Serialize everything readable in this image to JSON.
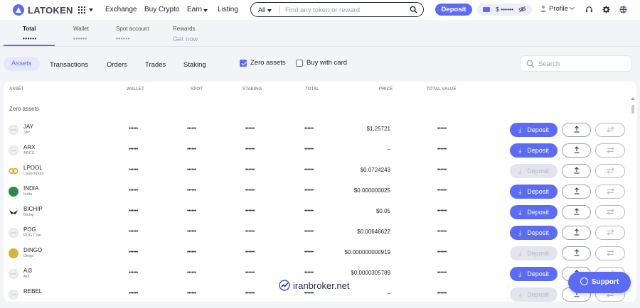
{
  "brand": {
    "name": "LATOKEN"
  },
  "nav": {
    "items": [
      "Exchange",
      "Buy Crypto",
      "Earn",
      "Listing"
    ]
  },
  "search": {
    "scope": "All",
    "placeholder": "Find any token or reward"
  },
  "header": {
    "deposit_label": "Deposit",
    "balance_masked": "$ ••••••",
    "profile_label": "Profile"
  },
  "summary_tabs": [
    {
      "label": "Total",
      "value": "••••••"
    },
    {
      "label": "Wallet",
      "value": "••••••"
    },
    {
      "label": "Spot account",
      "value": "••••••"
    },
    {
      "label": "Rewards",
      "value": "Get now"
    }
  ],
  "sub_tabs": [
    "Assets",
    "Transactions",
    "Orders",
    "Trades",
    "Staking"
  ],
  "filters": {
    "zero_assets": {
      "label": "Zero assets",
      "checked": true
    },
    "buy_with_card": {
      "label": "Buy with card",
      "checked": false
    }
  },
  "asset_search": {
    "placeholder": "Search"
  },
  "table": {
    "headers": [
      "ASSET",
      "WALLET",
      "SPOT",
      "STAKING",
      "TOTAL",
      "PRICE",
      "TOTAL VALUE"
    ],
    "section_caption": "Zero assets",
    "rows": [
      {
        "symbol": "JAY",
        "name": "JAY",
        "wallet": "••••••",
        "spot": "••••••",
        "staking": "••••••",
        "total": "••••••",
        "price": "$1.25721",
        "total_value": "••••••",
        "deposit_enabled": true
      },
      {
        "symbol": "ARX",
        "name": "ARCS",
        "wallet": "••••••",
        "spot": "••••••",
        "staking": "••••••",
        "total": "••••••",
        "price": "–",
        "total_value": "••••••",
        "deposit_enabled": true
      },
      {
        "symbol": "LPOOL",
        "name": "Launchpool",
        "wallet": "••••••",
        "spot": "••••••",
        "staking": "••••••",
        "total": "••••••",
        "price": "$0.0724243",
        "total_value": "••••••",
        "deposit_enabled": false
      },
      {
        "symbol": "INDIA",
        "name": "India",
        "wallet": "••••••",
        "spot": "••••••",
        "staking": "••••••",
        "total": "••••••",
        "price": "$0.000000025",
        "total_value": "••••••",
        "deposit_enabled": true
      },
      {
        "symbol": "BICHIP",
        "name": "Bichip",
        "wallet": "••••••",
        "spot": "••••••",
        "staking": "••••••",
        "total": "••••••",
        "price": "$0.05",
        "total_value": "••••••",
        "deposit_enabled": true
      },
      {
        "symbol": "POG",
        "name": "POG Coin",
        "wallet": "••••••",
        "spot": "••••••",
        "staking": "••••••",
        "total": "••••••",
        "price": "$0.00646622",
        "total_value": "••••••",
        "deposit_enabled": true
      },
      {
        "symbol": "DINGO",
        "name": "Dingo",
        "wallet": "••••••",
        "spot": "••••••",
        "staking": "••••••",
        "total": "••••••",
        "price": "$0.000000000919",
        "total_value": "••••••",
        "deposit_enabled": false
      },
      {
        "symbol": "AI3",
        "name": "AI3",
        "wallet": "••••••",
        "spot": "••••••",
        "staking": "••••••",
        "total": "••••••",
        "price": "$0.0000305789",
        "total_value": "••••••",
        "deposit_enabled": true
      },
      {
        "symbol": "REBEL",
        "name": "",
        "wallet": "••••••",
        "spot": "••••••",
        "staking": "••••••",
        "total": "••••••",
        "price": "–",
        "total_value": "••••••",
        "deposit_enabled": false
      }
    ],
    "row_deposit_label": "Deposit"
  },
  "watermark": "iranbroker.net",
  "support": {
    "label": "Support"
  },
  "colors": {
    "accent": "#5b6cf2",
    "background": "#f3f4f8",
    "panel": "#ffffff"
  },
  "icons": [
    "logo-icon",
    "apps-grid-icon",
    "search-icon",
    "wallet-card-icon",
    "eye-off-icon",
    "user-icon",
    "headset-icon",
    "settings-icon",
    "uk-flag-icon",
    "deposit-arrow-icon",
    "withdraw-icon",
    "transfer-icon",
    "chat-bubble-icon"
  ]
}
